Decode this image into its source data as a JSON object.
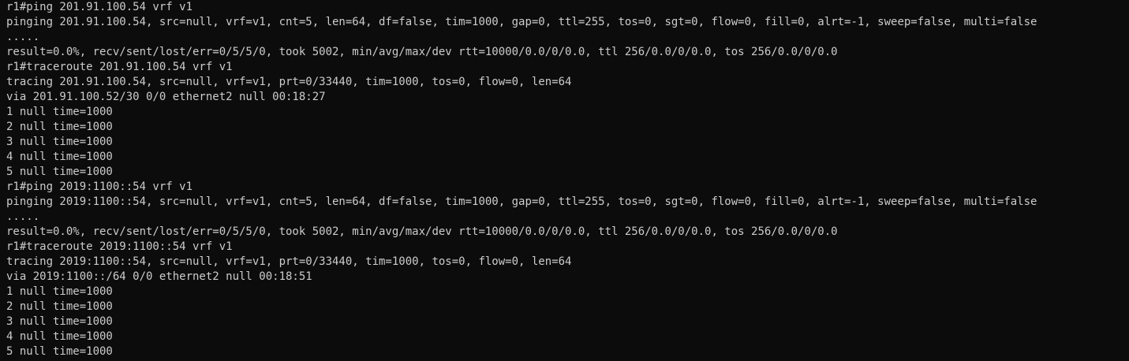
{
  "terminal": {
    "lines": [
      "r1#ping 201.91.100.54 vrf v1",
      "pinging 201.91.100.54, src=null, vrf=v1, cnt=5, len=64, df=false, tim=1000, gap=0, ttl=255, tos=0, sgt=0, flow=0, fill=0, alrt=-1, sweep=false, multi=false",
      ".....",
      "result=0.0%, recv/sent/lost/err=0/5/5/0, took 5002, min/avg/max/dev rtt=10000/0.0/0/0.0, ttl 256/0.0/0/0.0, tos 256/0.0/0/0.0",
      "r1#traceroute 201.91.100.54 vrf v1",
      "tracing 201.91.100.54, src=null, vrf=v1, prt=0/33440, tim=1000, tos=0, flow=0, len=64",
      "via 201.91.100.52/30 0/0 ethernet2 null 00:18:27",
      "1 null time=1000",
      "2 null time=1000",
      "3 null time=1000",
      "4 null time=1000",
      "5 null time=1000",
      "r1#ping 2019:1100::54 vrf v1",
      "pinging 2019:1100::54, src=null, vrf=v1, cnt=5, len=64, df=false, tim=1000, gap=0, ttl=255, tos=0, sgt=0, flow=0, fill=0, alrt=-1, sweep=false, multi=false",
      ".....",
      "result=0.0%, recv/sent/lost/err=0/5/5/0, took 5002, min/avg/max/dev rtt=10000/0.0/0/0.0, ttl 256/0.0/0/0.0, tos 256/0.0/0/0.0",
      "r1#traceroute 2019:1100::54 vrf v1",
      "tracing 2019:1100::54, src=null, vrf=v1, prt=0/33440, tim=1000, tos=0, flow=0, len=64",
      "via 2019:1100::/64 0/0 ethernet2 null 00:18:51",
      "1 null time=1000",
      "2 null time=1000",
      "3 null time=1000",
      "4 null time=1000",
      "5 null time=1000"
    ]
  },
  "colors": {
    "background": "#0c0c0c",
    "text": "#cccccc"
  }
}
